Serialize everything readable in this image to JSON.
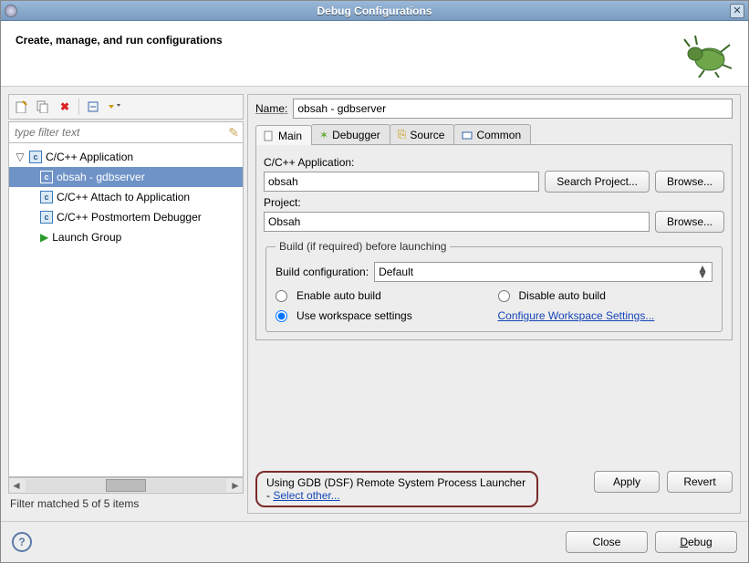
{
  "window": {
    "title": "Debug Configurations"
  },
  "header": {
    "title": "Create, manage, and run configurations"
  },
  "left": {
    "filter_placeholder": "type filter text",
    "tree": {
      "root": "C/C++ Application",
      "children": [
        "obsah - gdbserver",
        "C/C++ Attach to Application",
        "C/C++ Postmortem Debugger",
        "Launch Group"
      ]
    },
    "status": "Filter matched 5 of 5 items"
  },
  "right": {
    "name_label": "Name:",
    "name_value": "obsah - gdbserver",
    "tabs": [
      "Main",
      "Debugger",
      "Source",
      "Common"
    ],
    "app_label": "C/C++ Application:",
    "app_value": "obsah",
    "search_btn": "Search Project...",
    "browse_btn": "Browse...",
    "project_label": "Project:",
    "project_value": "Obsah",
    "build_group": "Build (if required) before launching",
    "build_cfg_label": "Build configuration:",
    "build_cfg_value": "Default",
    "enable_auto": "Enable auto build",
    "disable_auto": "Disable auto build",
    "use_workspace": "Use workspace settings",
    "cfg_ws_link": "Configure Workspace Settings...",
    "launcher_text": "Using GDB (DSF) Remote System Process Launcher - ",
    "select_other": "Select other...",
    "apply": "Apply",
    "revert": "Revert"
  },
  "footer": {
    "close": "Close",
    "debug": "Debug"
  }
}
